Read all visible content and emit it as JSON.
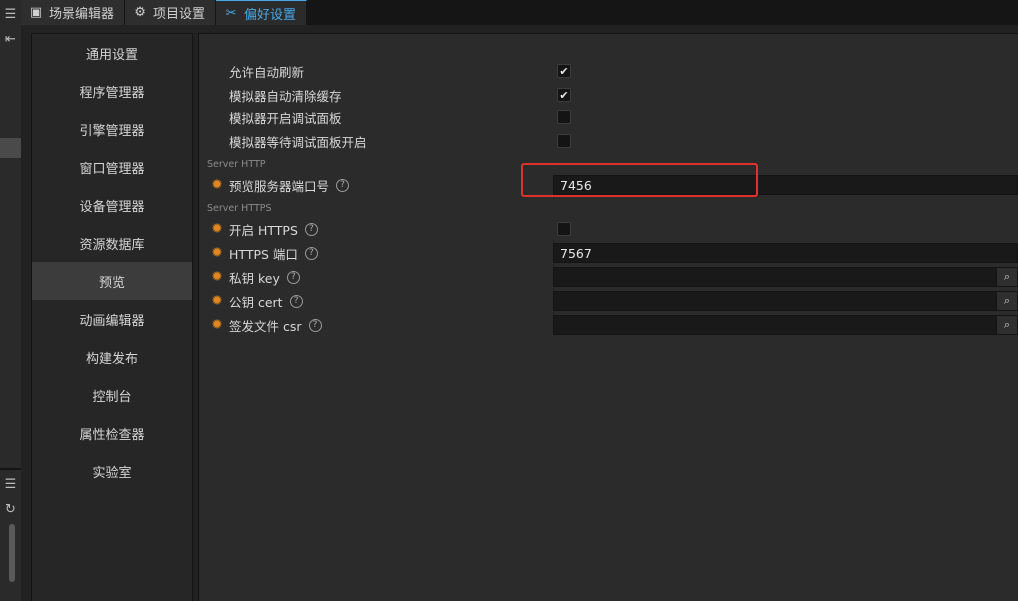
{
  "tabs": [
    {
      "label": "场景编辑器",
      "icon": "scene-editor-icon",
      "active": false
    },
    {
      "label": "项目设置",
      "icon": "gear-icon",
      "active": false
    },
    {
      "label": "偏好设置",
      "icon": "tools-icon",
      "active": true
    }
  ],
  "nav": {
    "items": [
      "通用设置",
      "程序管理器",
      "引擎管理器",
      "窗口管理器",
      "设备管理器",
      "资源数据库",
      "预览",
      "动画编辑器",
      "构建发布",
      "控制台",
      "属性检查器",
      "实验室"
    ],
    "active_index": 6
  },
  "settings": {
    "auto_refresh": {
      "label": "允许自动刷新",
      "checked": true
    },
    "sim_clear_cache": {
      "label": "模拟器自动清除缓存",
      "checked": true
    },
    "sim_debug_panel": {
      "label": "模拟器开启调试面板",
      "checked": false
    },
    "sim_wait_debug": {
      "label": "模拟器等待调试面板开启",
      "checked": false
    }
  },
  "section_http": "Server HTTP",
  "server_port": {
    "label": "预览服务器端口号",
    "value": "7456"
  },
  "section_https": "Server HTTPS",
  "enable_https": {
    "label": "开启 HTTPS",
    "checked": false
  },
  "https_port": {
    "label": "HTTPS 端口",
    "value": "7567"
  },
  "private_key": {
    "label": "私钥 key",
    "value": ""
  },
  "public_cert": {
    "label": "公钥 cert",
    "value": ""
  },
  "csr_file": {
    "label": "签发文件 csr",
    "value": ""
  },
  "colors": {
    "accent": "#4aa8e8",
    "gear": "#e0861d",
    "highlight": "#e0302b"
  }
}
